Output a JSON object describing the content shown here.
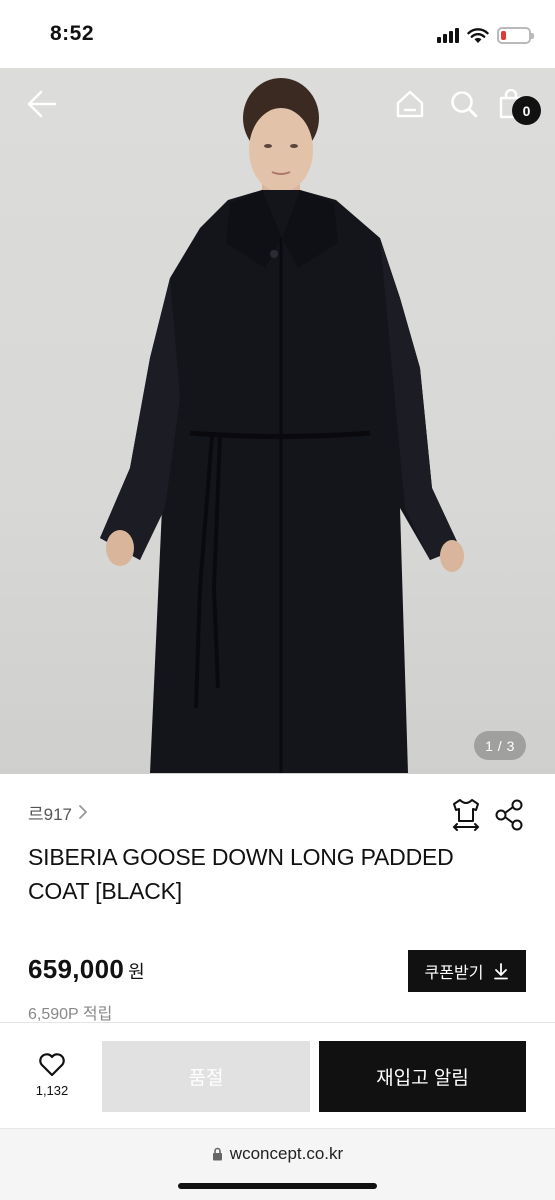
{
  "status_bar": {
    "time": "8:52",
    "battery_color": "#e03a3a"
  },
  "hero": {
    "pager": "1 / 3",
    "cart_count": "0",
    "icons": [
      "back-arrow-icon",
      "home-icon",
      "search-icon",
      "shopping-bag-icon"
    ]
  },
  "product": {
    "brand": "르917",
    "title": "SIBERIA GOOSE DOWN LONG PADDED COAT [BLACK]",
    "price": "659,000",
    "currency": "원",
    "points": "6,590P 적립",
    "coupon_label": "쿠폰받기"
  },
  "actions": {
    "like_count": "1,132",
    "soldout_label": "품절",
    "restock_label": "재입고 알림"
  },
  "browser": {
    "url": "wconcept.co.kr"
  },
  "colors": {
    "primary": "#111111",
    "disabled": "#e1e1e1",
    "muted": "#888888"
  }
}
